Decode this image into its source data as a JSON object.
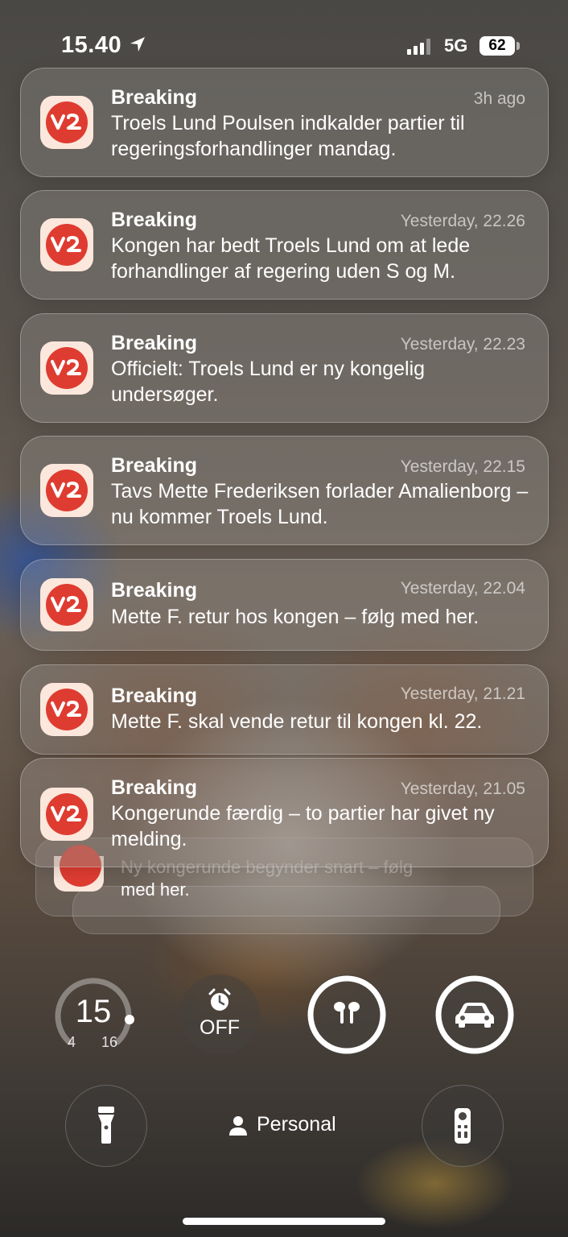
{
  "status": {
    "time": "15.40",
    "network": "5G",
    "battery": "62"
  },
  "app": {
    "icon_name": "tv2-app-icon",
    "brand_color": "#df3c31"
  },
  "notifications": [
    {
      "title": "Breaking",
      "time": "3h ago",
      "body": "Troels Lund Poulsen indkalder partier til regeringsforhandlinger mandag."
    },
    {
      "title": "Breaking",
      "time": "Yesterday, 22.26",
      "body": "Kongen har bedt Troels Lund om at lede forhandlinger af regering uden S og M."
    },
    {
      "title": "Breaking",
      "time": "Yesterday, 22.23",
      "body": "Officielt: Troels Lund er ny kongelig undersøger."
    },
    {
      "title": "Breaking",
      "time": "Yesterday, 22.15",
      "body": "Tavs Mette Frederiksen forlader Amalienborg – nu kommer Troels Lund."
    },
    {
      "title": "Breaking",
      "time": "Yesterday, 22.04",
      "body": "Mette F. retur hos kongen – følg med her."
    },
    {
      "title": "Breaking",
      "time": "Yesterday, 21.21",
      "body": "Mette F. skal vende retur til kongen kl. 22."
    },
    {
      "title": "Breaking",
      "time": "Yesterday, 21.05",
      "body": "Kongerunde færdig – to partier har givet ny melding."
    }
  ],
  "stacked_notification": {
    "body_partial": "Ny kongerunde begynder snart – følg",
    "body_line2": "med her."
  },
  "widgets": {
    "temperature": {
      "current": "15",
      "low": "4",
      "high": "16"
    },
    "alarm": {
      "label": "OFF",
      "icon": "alarm-clock-icon"
    },
    "airpods": {
      "icon": "airpods-icon"
    },
    "car": {
      "icon": "car-icon"
    }
  },
  "bottom": {
    "flashlight_icon": "flashlight-icon",
    "focus_label": "Personal",
    "focus_icon": "person-icon",
    "remote_icon": "tv-remote-icon"
  }
}
